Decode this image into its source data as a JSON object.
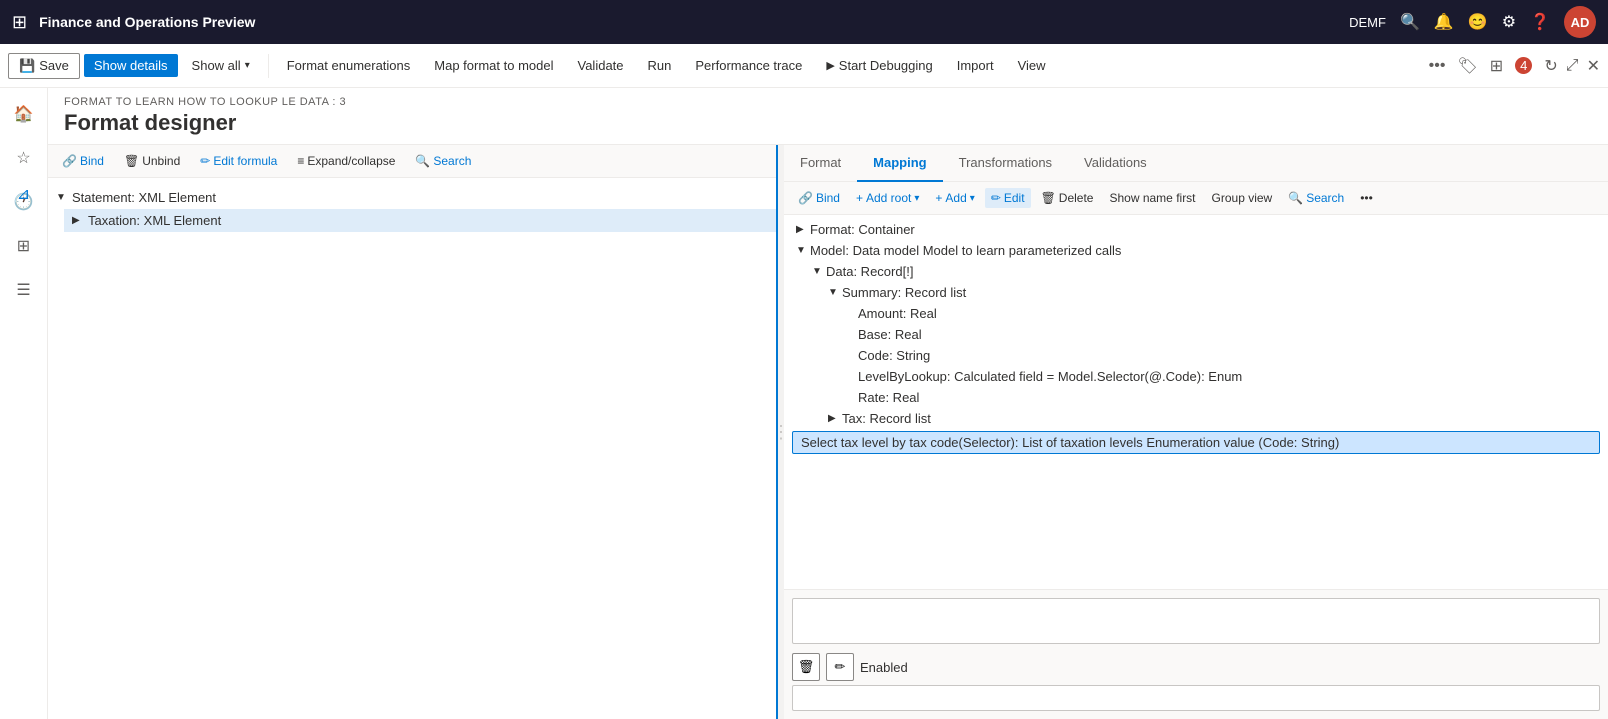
{
  "titleBar": {
    "appName": "Finance and Operations Preview",
    "user": "DEMF",
    "userInitials": "AD",
    "icons": {
      "search": "🔍",
      "bell": "🔔",
      "person": "😊",
      "gear": "⚙",
      "help": "❓"
    }
  },
  "toolbar": {
    "save": "Save",
    "showDetails": "Show details",
    "showAll": "Show all",
    "formatEnumerations": "Format enumerations",
    "mapFormatToModel": "Map format to model",
    "validate": "Validate",
    "run": "Run",
    "performanceTrace": "Performance trace",
    "startDebugging": "Start Debugging",
    "import": "Import",
    "view": "View"
  },
  "pageHeader": {
    "breadcrumb": "FORMAT TO LEARN HOW TO LOOKUP LE DATA : 3",
    "title": "Format designer"
  },
  "formatPanel": {
    "actions": {
      "bind": "Bind",
      "unbind": "Unbind",
      "editFormula": "Edit formula",
      "expandCollapse": "Expand/collapse",
      "search": "Search"
    },
    "tree": [
      {
        "label": "Statement: XML Element",
        "expanded": true,
        "level": 0
      },
      {
        "label": "Taxation: XML Element",
        "expanded": false,
        "level": 1,
        "selected": true
      }
    ]
  },
  "mappingPanel": {
    "tabs": [
      "Format",
      "Mapping",
      "Transformations",
      "Validations"
    ],
    "activeTab": "Mapping",
    "toolbar": {
      "bind": "Bind",
      "addRoot": "Add root",
      "add": "Add",
      "edit": "Edit",
      "delete": "Delete",
      "showNameFirst": "Show name first",
      "groupView": "Group view",
      "search": "Search"
    },
    "tree": [
      {
        "label": "Format: Container",
        "level": 0,
        "expanded": false,
        "indent": 0
      },
      {
        "label": "Model: Data model Model to learn parameterized calls",
        "level": 0,
        "expanded": true,
        "indent": 1
      },
      {
        "label": "Data: Record[!]",
        "level": 1,
        "expanded": true,
        "indent": 2
      },
      {
        "label": "Summary: Record list",
        "level": 2,
        "expanded": true,
        "indent": 3
      },
      {
        "label": "Amount: Real",
        "level": 3,
        "expanded": false,
        "indent": 4
      },
      {
        "label": "Base: Real",
        "level": 3,
        "expanded": false,
        "indent": 4
      },
      {
        "label": "Code: String",
        "level": 3,
        "expanded": false,
        "indent": 4
      },
      {
        "label": "LevelByLookup: Calculated field = Model.Selector(@.Code): Enum",
        "level": 3,
        "expanded": false,
        "indent": 4
      },
      {
        "label": "Rate: Real",
        "level": 3,
        "expanded": false,
        "indent": 4
      },
      {
        "label": "Tax: Record list",
        "level": 2,
        "expanded": false,
        "indent": 3
      }
    ],
    "selectedFormula": "Select tax level by tax code(Selector): List of taxation levels Enumeration value (Code: String)",
    "formulaLabel": "Enabled"
  }
}
